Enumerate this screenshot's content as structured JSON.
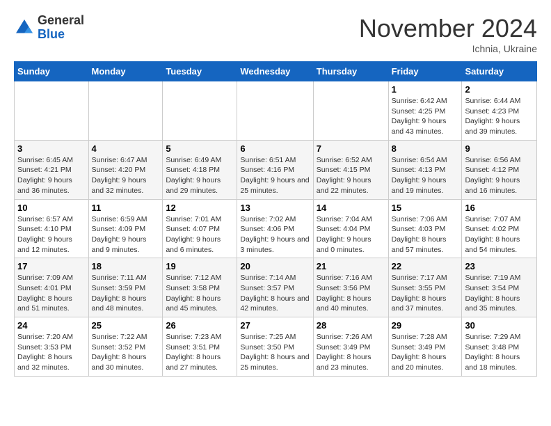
{
  "logo": {
    "general": "General",
    "blue": "Blue"
  },
  "title": "November 2024",
  "location": "Ichnia, Ukraine",
  "days_of_week": [
    "Sunday",
    "Monday",
    "Tuesday",
    "Wednesday",
    "Thursday",
    "Friday",
    "Saturday"
  ],
  "weeks": [
    [
      {
        "day": "",
        "info": ""
      },
      {
        "day": "",
        "info": ""
      },
      {
        "day": "",
        "info": ""
      },
      {
        "day": "",
        "info": ""
      },
      {
        "day": "",
        "info": ""
      },
      {
        "day": "1",
        "info": "Sunrise: 6:42 AM\nSunset: 4:25 PM\nDaylight: 9 hours and 43 minutes."
      },
      {
        "day": "2",
        "info": "Sunrise: 6:44 AM\nSunset: 4:23 PM\nDaylight: 9 hours and 39 minutes."
      }
    ],
    [
      {
        "day": "3",
        "info": "Sunrise: 6:45 AM\nSunset: 4:21 PM\nDaylight: 9 hours and 36 minutes."
      },
      {
        "day": "4",
        "info": "Sunrise: 6:47 AM\nSunset: 4:20 PM\nDaylight: 9 hours and 32 minutes."
      },
      {
        "day": "5",
        "info": "Sunrise: 6:49 AM\nSunset: 4:18 PM\nDaylight: 9 hours and 29 minutes."
      },
      {
        "day": "6",
        "info": "Sunrise: 6:51 AM\nSunset: 4:16 PM\nDaylight: 9 hours and 25 minutes."
      },
      {
        "day": "7",
        "info": "Sunrise: 6:52 AM\nSunset: 4:15 PM\nDaylight: 9 hours and 22 minutes."
      },
      {
        "day": "8",
        "info": "Sunrise: 6:54 AM\nSunset: 4:13 PM\nDaylight: 9 hours and 19 minutes."
      },
      {
        "day": "9",
        "info": "Sunrise: 6:56 AM\nSunset: 4:12 PM\nDaylight: 9 hours and 16 minutes."
      }
    ],
    [
      {
        "day": "10",
        "info": "Sunrise: 6:57 AM\nSunset: 4:10 PM\nDaylight: 9 hours and 12 minutes."
      },
      {
        "day": "11",
        "info": "Sunrise: 6:59 AM\nSunset: 4:09 PM\nDaylight: 9 hours and 9 minutes."
      },
      {
        "day": "12",
        "info": "Sunrise: 7:01 AM\nSunset: 4:07 PM\nDaylight: 9 hours and 6 minutes."
      },
      {
        "day": "13",
        "info": "Sunrise: 7:02 AM\nSunset: 4:06 PM\nDaylight: 9 hours and 3 minutes."
      },
      {
        "day": "14",
        "info": "Sunrise: 7:04 AM\nSunset: 4:04 PM\nDaylight: 9 hours and 0 minutes."
      },
      {
        "day": "15",
        "info": "Sunrise: 7:06 AM\nSunset: 4:03 PM\nDaylight: 8 hours and 57 minutes."
      },
      {
        "day": "16",
        "info": "Sunrise: 7:07 AM\nSunset: 4:02 PM\nDaylight: 8 hours and 54 minutes."
      }
    ],
    [
      {
        "day": "17",
        "info": "Sunrise: 7:09 AM\nSunset: 4:01 PM\nDaylight: 8 hours and 51 minutes."
      },
      {
        "day": "18",
        "info": "Sunrise: 7:11 AM\nSunset: 3:59 PM\nDaylight: 8 hours and 48 minutes."
      },
      {
        "day": "19",
        "info": "Sunrise: 7:12 AM\nSunset: 3:58 PM\nDaylight: 8 hours and 45 minutes."
      },
      {
        "day": "20",
        "info": "Sunrise: 7:14 AM\nSunset: 3:57 PM\nDaylight: 8 hours and 42 minutes."
      },
      {
        "day": "21",
        "info": "Sunrise: 7:16 AM\nSunset: 3:56 PM\nDaylight: 8 hours and 40 minutes."
      },
      {
        "day": "22",
        "info": "Sunrise: 7:17 AM\nSunset: 3:55 PM\nDaylight: 8 hours and 37 minutes."
      },
      {
        "day": "23",
        "info": "Sunrise: 7:19 AM\nSunset: 3:54 PM\nDaylight: 8 hours and 35 minutes."
      }
    ],
    [
      {
        "day": "24",
        "info": "Sunrise: 7:20 AM\nSunset: 3:53 PM\nDaylight: 8 hours and 32 minutes."
      },
      {
        "day": "25",
        "info": "Sunrise: 7:22 AM\nSunset: 3:52 PM\nDaylight: 8 hours and 30 minutes."
      },
      {
        "day": "26",
        "info": "Sunrise: 7:23 AM\nSunset: 3:51 PM\nDaylight: 8 hours and 27 minutes."
      },
      {
        "day": "27",
        "info": "Sunrise: 7:25 AM\nSunset: 3:50 PM\nDaylight: 8 hours and 25 minutes."
      },
      {
        "day": "28",
        "info": "Sunrise: 7:26 AM\nSunset: 3:49 PM\nDaylight: 8 hours and 23 minutes."
      },
      {
        "day": "29",
        "info": "Sunrise: 7:28 AM\nSunset: 3:49 PM\nDaylight: 8 hours and 20 minutes."
      },
      {
        "day": "30",
        "info": "Sunrise: 7:29 AM\nSunset: 3:48 PM\nDaylight: 8 hours and 18 minutes."
      }
    ]
  ]
}
